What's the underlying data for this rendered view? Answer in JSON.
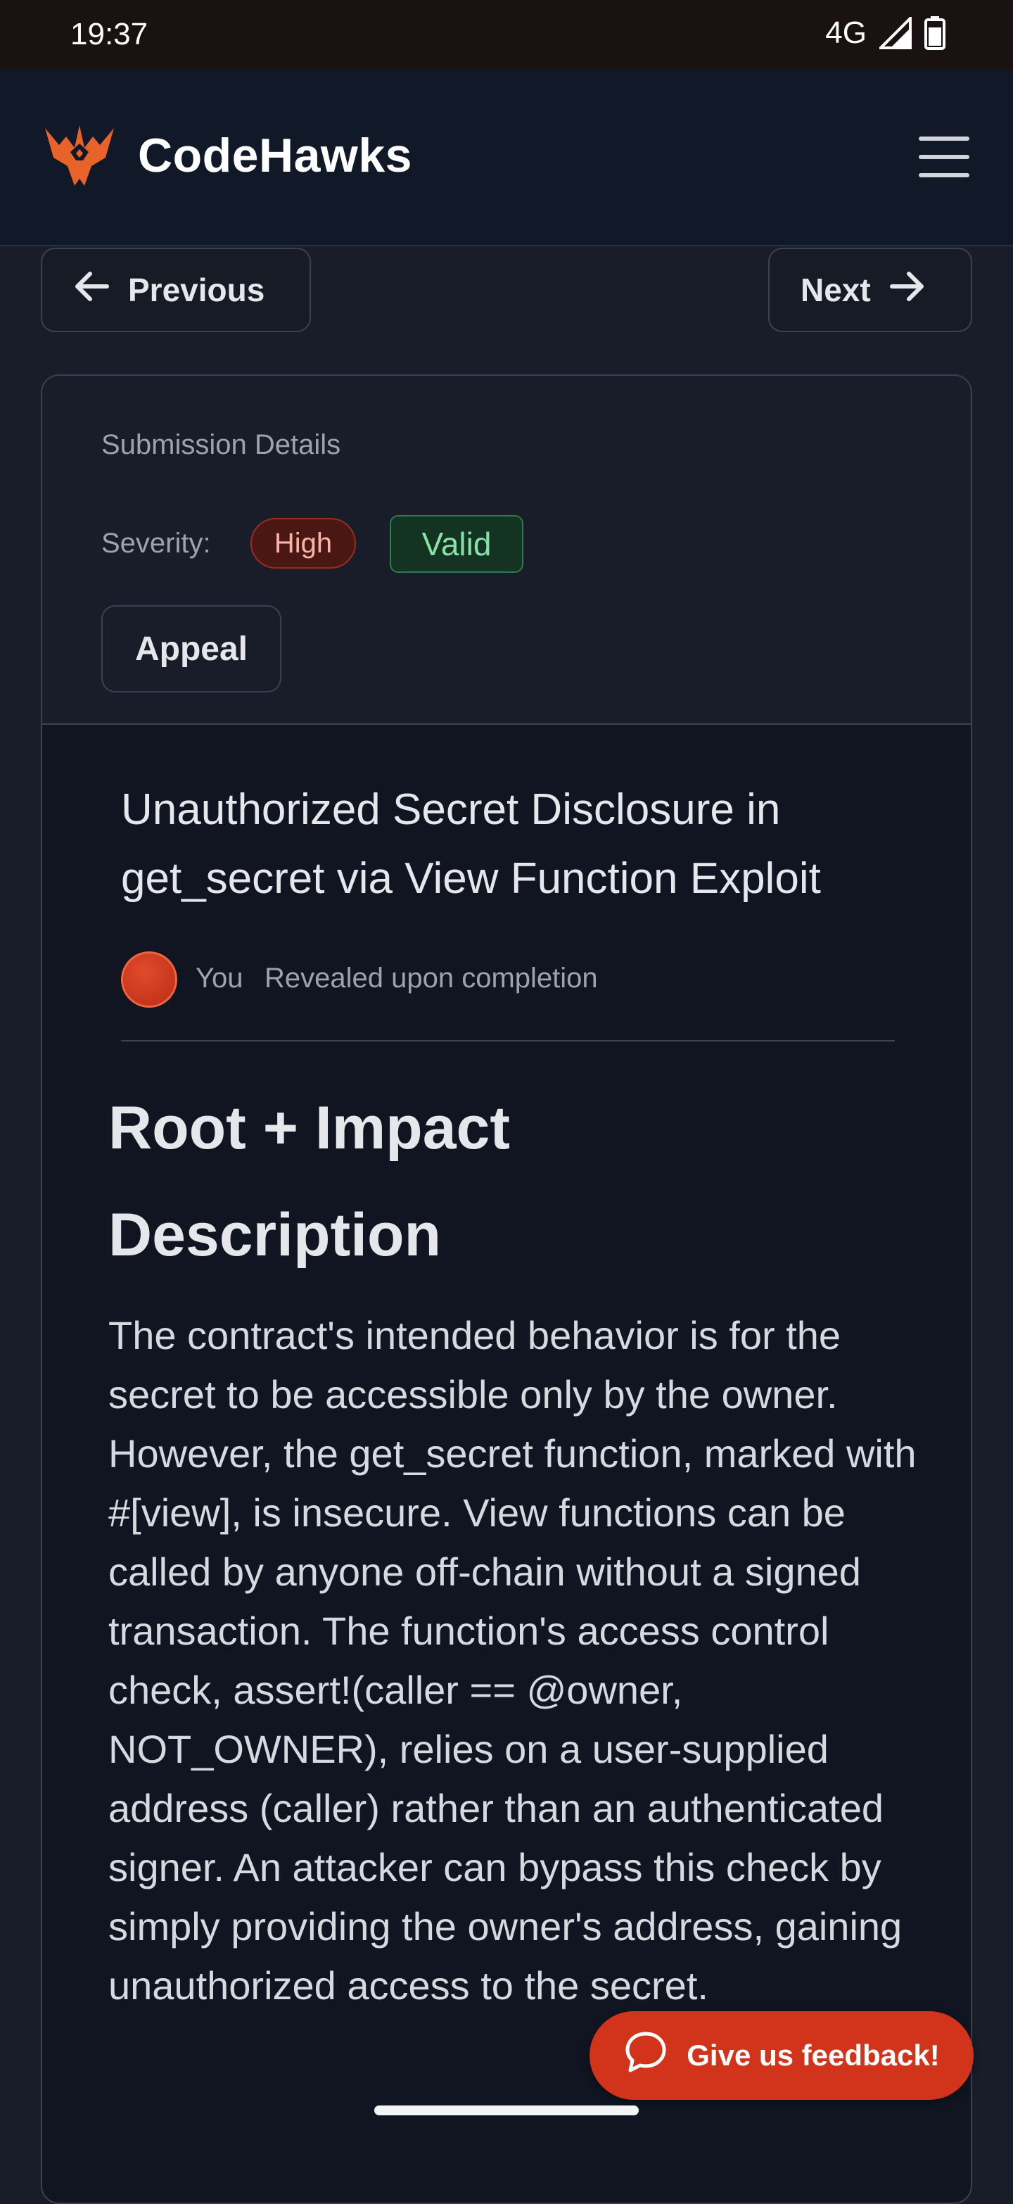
{
  "status_bar": {
    "time": "19:37",
    "network": "4G"
  },
  "header": {
    "brand": "CodeHawks",
    "logo_icon": "hawk-logo-icon",
    "menu_icon": "hamburger-menu-icon"
  },
  "nav": {
    "previous_label": "Previous",
    "next_label": "Next"
  },
  "submission": {
    "details_label": "Submission Details",
    "severity_label": "Severity:",
    "severity_value": "High",
    "status_value": "Valid",
    "appeal_label": "Appeal"
  },
  "report": {
    "title": "Unauthorized Secret Disclosure in get_secret via View Function Exploit",
    "author": "You",
    "author_meta": "Revealed upon completion",
    "heading_root": "Root + Impact",
    "heading_description": "Description",
    "description": "The contract's intended behavior is for the secret to be accessible only by the owner. However, the get_secret function, marked with #[view], is insecure. View functions can be called by anyone off-chain without a signed transaction. The function's access control check, assert!(caller == @owner, NOT_OWNER), relies on a user-supplied address (caller) rather than an authenticated signer. An attacker can bypass this check by simply providing the owner's address, gaining unauthorized access to the secret."
  },
  "feedback": {
    "label": "Give us feedback!"
  },
  "colors": {
    "accent": "#d1331b",
    "high": "#9b2d1f",
    "valid": "#2f7a4a",
    "background": "#181d29"
  }
}
